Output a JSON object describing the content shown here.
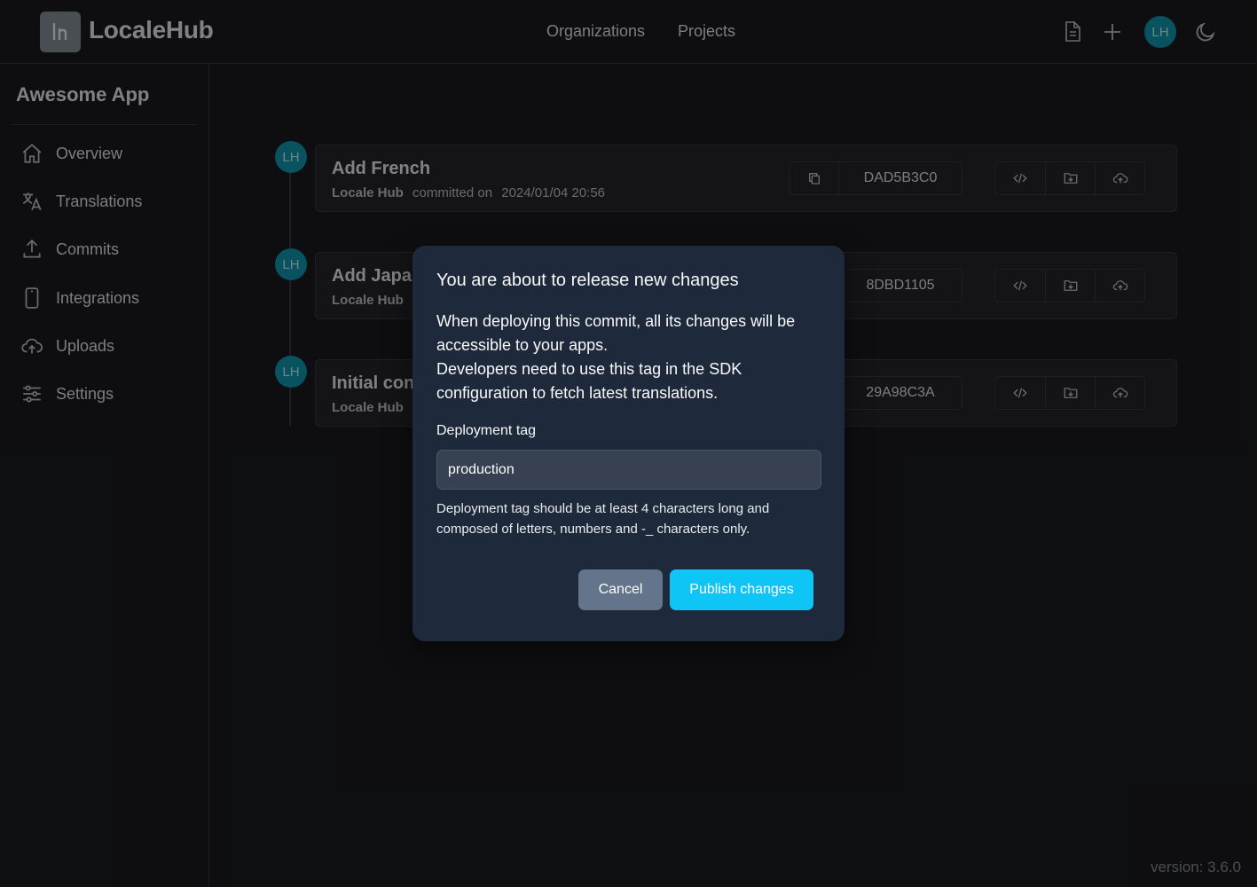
{
  "header": {
    "app_name": "LocaleHub",
    "nav": [
      "Organizations",
      "Projects"
    ],
    "avatar_initials": "LH"
  },
  "sidebar": {
    "project_title": "Awesome App",
    "items": [
      {
        "label": "Overview",
        "icon": "home-icon"
      },
      {
        "label": "Translations",
        "icon": "language-icon"
      },
      {
        "label": "Commits",
        "icon": "upload-icon"
      },
      {
        "label": "Integrations",
        "icon": "device-mobile-icon"
      },
      {
        "label": "Uploads",
        "icon": "cloud-upload-icon"
      },
      {
        "label": "Settings",
        "icon": "sliders-icon"
      }
    ]
  },
  "commits": [
    {
      "title": "Add French",
      "author": "Locale Hub",
      "committed_on": "committed on",
      "date": "2024/01/04 20:56",
      "hash": "DAD5B3C0",
      "avatar": "LH"
    },
    {
      "title": "Add Japa",
      "author": "Locale Hub",
      "hash": "8DBD1105",
      "avatar": "LH"
    },
    {
      "title": "Initial con",
      "author": "Locale Hub",
      "hash": "29A98C3A",
      "avatar": "LH"
    }
  ],
  "footer": {
    "version": "version: 3.6.0"
  },
  "modal": {
    "title": "You are about to release new changes",
    "body_line1": "When deploying this commit, all its changes will be accessible to your apps.",
    "body_line2": "Developers need to use this tag in the SDK configuration to fetch latest translations.",
    "field_label": "Deployment tag",
    "field_value": "production",
    "field_hint": "Deployment tag should be at least 4 characters long and composed of letters, numbers and -_ characters only.",
    "cancel_label": "Cancel",
    "publish_label": "Publish changes"
  },
  "colors": {
    "background": "#1a1b1e",
    "modal_background": "#1e293b",
    "accent": "#0fc5f5",
    "avatar": "#1098ad"
  }
}
